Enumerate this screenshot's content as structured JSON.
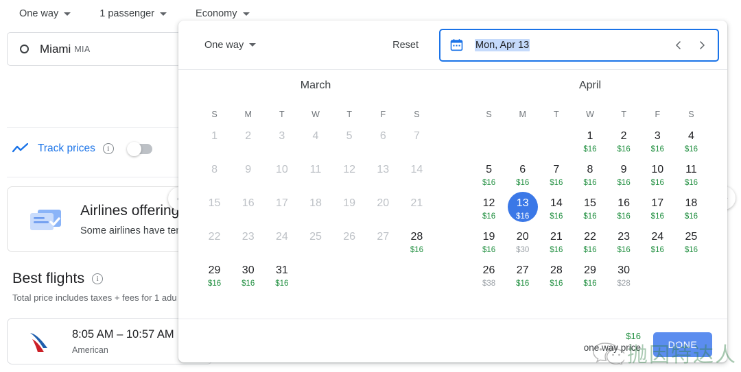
{
  "topbar": {
    "trip_type": "One way",
    "passengers": "1 passenger",
    "cabin": "Economy"
  },
  "search": {
    "origin_city": "Miami",
    "origin_code": "MIA"
  },
  "track_prices": {
    "label": "Track prices",
    "toggle_state": "off"
  },
  "notice": {
    "title": "Airlines offering",
    "subtitle": "Some airlines have temp"
  },
  "best_flights": {
    "heading": "Best flights",
    "subtext": "Total price includes taxes + fees for 1 adu"
  },
  "flight_row": {
    "times": "8:05 AM – 10:57 AM",
    "airline": "American"
  },
  "dialog": {
    "trip_type": "One way",
    "reset_label": "Reset",
    "date_value": "Mon, Apr 13",
    "done_label": "DONE",
    "legend_price": "$16",
    "legend_label": "one way price",
    "weekdays": [
      "S",
      "M",
      "T",
      "W",
      "T",
      "F",
      "S"
    ],
    "months": [
      {
        "name": "March",
        "lead_blanks": 0,
        "days": [
          {
            "n": "1",
            "price": "",
            "state": "disabled"
          },
          {
            "n": "2",
            "price": "",
            "state": "disabled"
          },
          {
            "n": "3",
            "price": "",
            "state": "disabled"
          },
          {
            "n": "4",
            "price": "",
            "state": "disabled"
          },
          {
            "n": "5",
            "price": "",
            "state": "disabled"
          },
          {
            "n": "6",
            "price": "",
            "state": "disabled"
          },
          {
            "n": "7",
            "price": "",
            "state": "disabled"
          },
          {
            "n": "8",
            "price": "",
            "state": "disabled"
          },
          {
            "n": "9",
            "price": "",
            "state": "disabled"
          },
          {
            "n": "10",
            "price": "",
            "state": "disabled"
          },
          {
            "n": "11",
            "price": "",
            "state": "disabled"
          },
          {
            "n": "12",
            "price": "",
            "state": "disabled"
          },
          {
            "n": "13",
            "price": "",
            "state": "disabled"
          },
          {
            "n": "14",
            "price": "",
            "state": "disabled"
          },
          {
            "n": "15",
            "price": "",
            "state": "disabled"
          },
          {
            "n": "16",
            "price": "",
            "state": "disabled"
          },
          {
            "n": "17",
            "price": "",
            "state": "disabled"
          },
          {
            "n": "18",
            "price": "",
            "state": "disabled"
          },
          {
            "n": "19",
            "price": "",
            "state": "disabled"
          },
          {
            "n": "20",
            "price": "",
            "state": "disabled"
          },
          {
            "n": "21",
            "price": "",
            "state": "disabled"
          },
          {
            "n": "22",
            "price": "",
            "state": "disabled"
          },
          {
            "n": "23",
            "price": "",
            "state": "disabled"
          },
          {
            "n": "24",
            "price": "",
            "state": "disabled"
          },
          {
            "n": "25",
            "price": "",
            "state": "disabled"
          },
          {
            "n": "26",
            "price": "",
            "state": "disabled"
          },
          {
            "n": "27",
            "price": "",
            "state": "disabled"
          },
          {
            "n": "28",
            "price": "$16",
            "state": "available"
          },
          {
            "n": "29",
            "price": "$16",
            "state": "available"
          },
          {
            "n": "30",
            "price": "$16",
            "state": "available"
          },
          {
            "n": "31",
            "price": "$16",
            "state": "available"
          }
        ]
      },
      {
        "name": "April",
        "lead_blanks": 3,
        "days": [
          {
            "n": "1",
            "price": "$16",
            "state": "available"
          },
          {
            "n": "2",
            "price": "$16",
            "state": "available"
          },
          {
            "n": "3",
            "price": "$16",
            "state": "available"
          },
          {
            "n": "4",
            "price": "$16",
            "state": "available"
          },
          {
            "n": "5",
            "price": "$16",
            "state": "available"
          },
          {
            "n": "6",
            "price": "$16",
            "state": "available"
          },
          {
            "n": "7",
            "price": "$16",
            "state": "available"
          },
          {
            "n": "8",
            "price": "$16",
            "state": "available"
          },
          {
            "n": "9",
            "price": "$16",
            "state": "available"
          },
          {
            "n": "10",
            "price": "$16",
            "state": "available"
          },
          {
            "n": "11",
            "price": "$16",
            "state": "available"
          },
          {
            "n": "12",
            "price": "$16",
            "state": "available"
          },
          {
            "n": "13",
            "price": "$16",
            "state": "selected"
          },
          {
            "n": "14",
            "price": "$16",
            "state": "available"
          },
          {
            "n": "15",
            "price": "$16",
            "state": "available"
          },
          {
            "n": "16",
            "price": "$16",
            "state": "available"
          },
          {
            "n": "17",
            "price": "$16",
            "state": "available"
          },
          {
            "n": "18",
            "price": "$16",
            "state": "available"
          },
          {
            "n": "19",
            "price": "$16",
            "state": "available"
          },
          {
            "n": "20",
            "price": "$30",
            "state": "high"
          },
          {
            "n": "21",
            "price": "$16",
            "state": "available"
          },
          {
            "n": "22",
            "price": "$16",
            "state": "available"
          },
          {
            "n": "23",
            "price": "$16",
            "state": "available"
          },
          {
            "n": "24",
            "price": "$16",
            "state": "available"
          },
          {
            "n": "25",
            "price": "$16",
            "state": "available"
          },
          {
            "n": "26",
            "price": "$38",
            "state": "high"
          },
          {
            "n": "27",
            "price": "$16",
            "state": "available"
          },
          {
            "n": "28",
            "price": "$16",
            "state": "available"
          },
          {
            "n": "29",
            "price": "$16",
            "state": "available"
          },
          {
            "n": "30",
            "price": "$28",
            "state": "high"
          }
        ]
      }
    ]
  },
  "watermark": {
    "text": "抛因特达人"
  },
  "colors": {
    "accent_blue": "#1a73e8",
    "selected_blue": "#3b78e7",
    "price_green": "#1e8e3e",
    "price_grey": "#9aa0a6",
    "done_blue": "#5b8def"
  }
}
